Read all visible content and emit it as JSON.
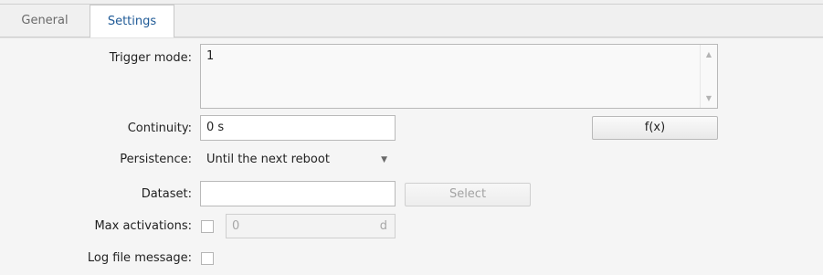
{
  "tabs": [
    {
      "label": "General",
      "active": false
    },
    {
      "label": "Settings",
      "active": true
    }
  ],
  "form": {
    "trigger_mode": {
      "label": "Trigger mode:",
      "value": "1"
    },
    "continuity": {
      "label": "Continuity:",
      "value": "0 s",
      "fx_button": "f(x)"
    },
    "persistence": {
      "label": "Persistence:",
      "value": "Until the next reboot"
    },
    "dataset": {
      "label": "Dataset:",
      "value": "",
      "select_button": "Select"
    },
    "max_activations": {
      "label": "Max activations:",
      "checked": false,
      "value": "0",
      "unit": "d"
    },
    "log_file_message": {
      "label": "Log file message:",
      "checked": false
    }
  },
  "icons": {
    "scroll_up": "chevron-up-icon",
    "scroll_down": "chevron-down-icon",
    "dropdown": "caret-down-icon"
  },
  "colors": {
    "active_tab_text": "#1f5a96",
    "panel_background": "#f5f5f5"
  }
}
